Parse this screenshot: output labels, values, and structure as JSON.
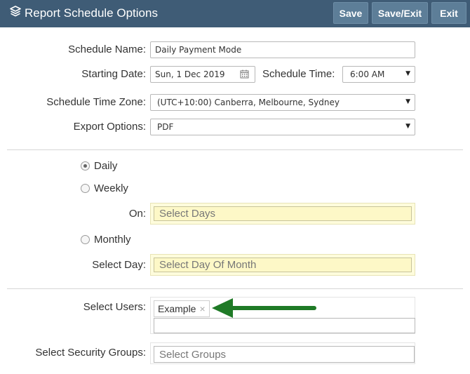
{
  "header": {
    "title": "Report Schedule Options",
    "save_label": "Save",
    "saveexit_label": "Save/Exit",
    "exit_label": "Exit"
  },
  "form": {
    "schedule_name_label": "Schedule Name:",
    "schedule_name_value": "Daily Payment Mode",
    "starting_date_label": "Starting Date:",
    "starting_date_value": "Sun, 1 Dec 2019",
    "schedule_time_label": "Schedule Time:",
    "schedule_time_value": "6:00 AM",
    "timezone_label": "Schedule Time Zone:",
    "timezone_value": "(UTC+10:00) Canberra, Melbourne, Sydney",
    "export_label": "Export Options:",
    "export_value": "PDF"
  },
  "frequency": {
    "daily_label": "Daily",
    "weekly_label": "Weekly",
    "on_label": "On:",
    "select_days_placeholder": "Select Days",
    "monthly_label": "Monthly",
    "select_day_label": "Select Day:",
    "select_day_of_month_placeholder": "Select Day Of Month",
    "selected": "Daily"
  },
  "recipients": {
    "select_users_label": "Select Users:",
    "user_tag": "Example",
    "tag_remove": "×",
    "select_groups_label": "Select Security Groups:",
    "select_groups_placeholder": "Select Groups"
  },
  "icons": {
    "layers": "layers-icon",
    "calendar": "calendar-icon",
    "dropdown": "chevron-down-icon"
  },
  "colors": {
    "header_bg": "#3f5c76",
    "button_bg": "#5d7e98",
    "highlight_field": "#fdf8c7",
    "annotation_arrow": "#1f7a26"
  }
}
